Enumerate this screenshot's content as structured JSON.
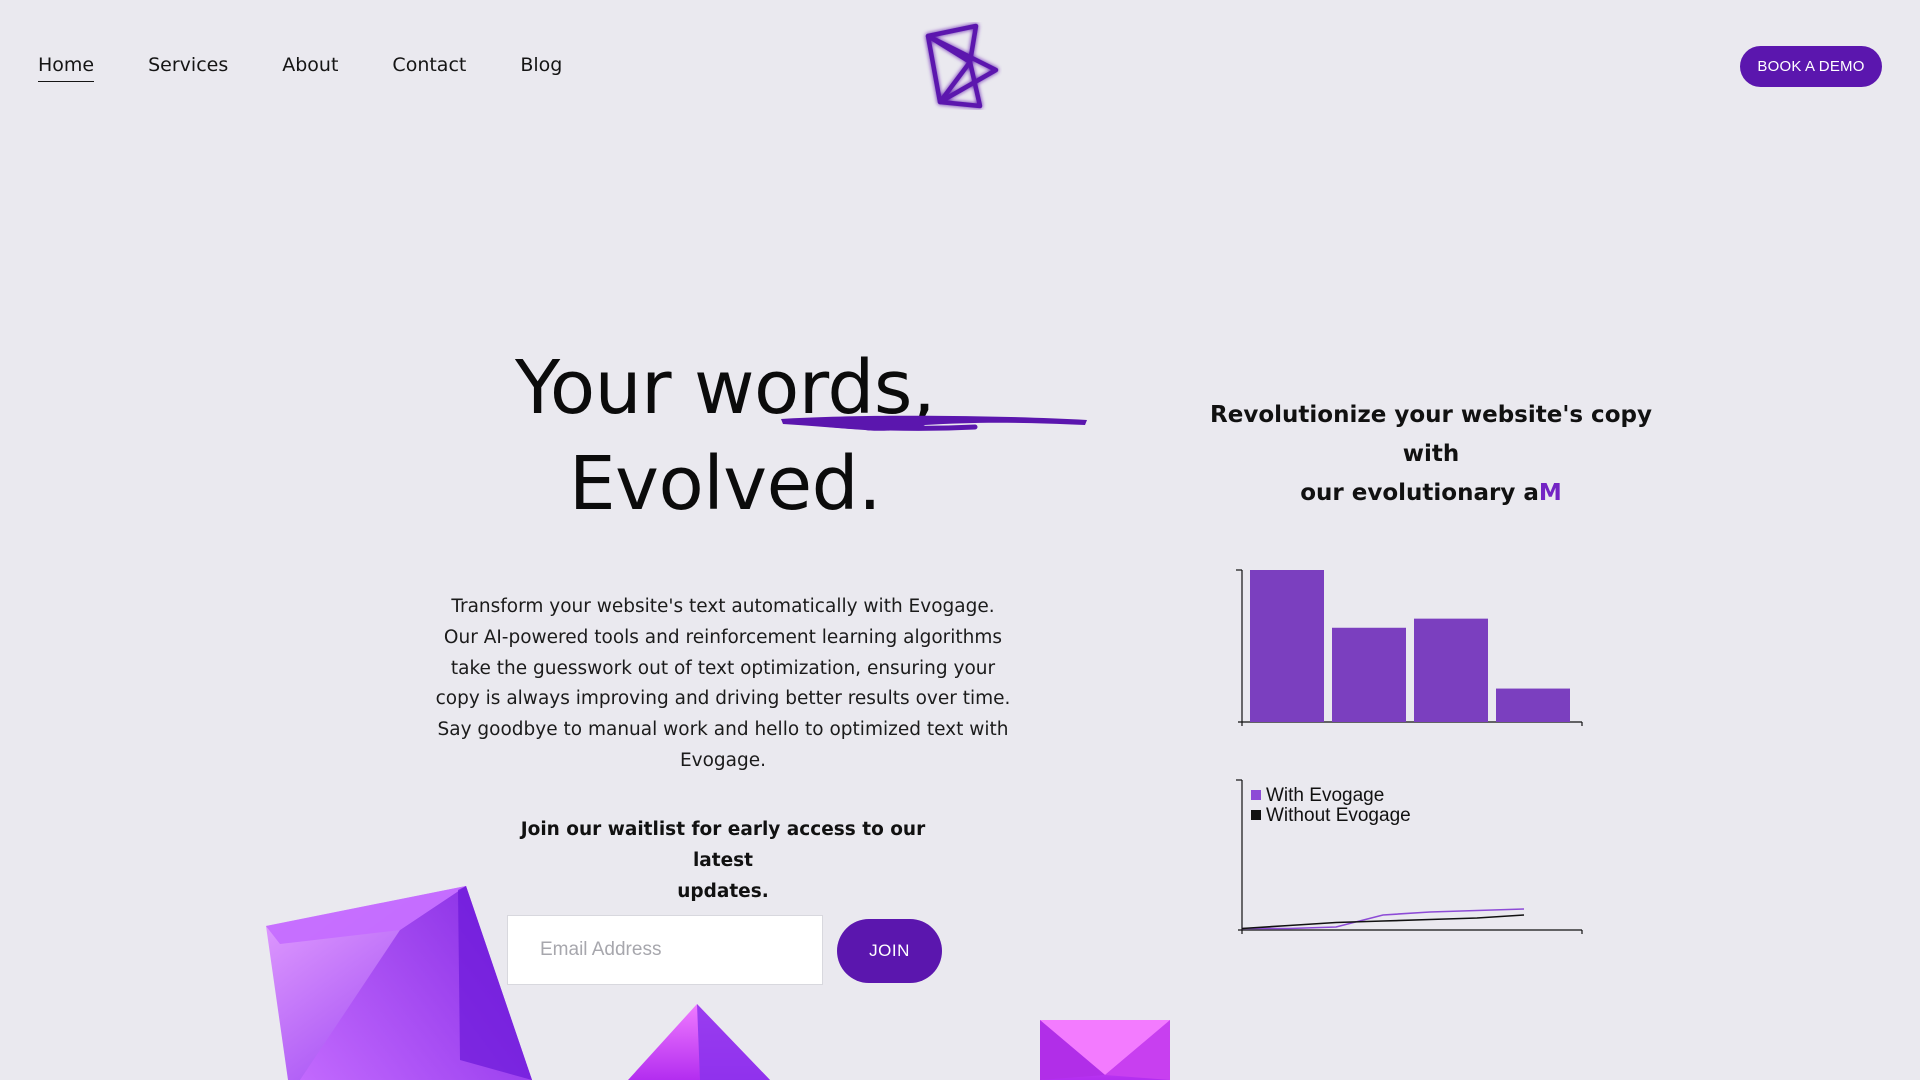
{
  "nav": {
    "items": [
      {
        "label": "Home",
        "active": true
      },
      {
        "label": "Services",
        "active": false
      },
      {
        "label": "About",
        "active": false
      },
      {
        "label": "Contact",
        "active": false
      },
      {
        "label": "Blog",
        "active": false
      }
    ],
    "cta_label": "BOOK A DEMO"
  },
  "hero": {
    "title_lead": "Your words, ",
    "title_accent": "Evolved."
  },
  "tagline": {
    "line1": "Revolutionize your website's copy with",
    "line2_lead": "our evolutionary a",
    "line2_accent": "M"
  },
  "body": {
    "lines": [
      "Transform your website's text automatically with Evogage.",
      "Our AI-powered tools and reinforcement learning algorithms",
      "take the guesswork out of text optimization, ensuring your",
      "copy is always improving and driving better results over time.",
      "Say goodbye to manual work and hello to optimized text with",
      "Evogage."
    ]
  },
  "waitlist": {
    "line1": "Join our waitlist for early access to our latest",
    "line2": "updates."
  },
  "form": {
    "email_placeholder": "Email Address",
    "email_value": "",
    "join_label": "JOIN"
  },
  "colors": {
    "accent": "#5b16ae",
    "bar": "#7b3fbf",
    "with_line": "#8d4bd6",
    "without_line": "#111111",
    "background": "#eae9ef"
  },
  "chart_data": [
    {
      "type": "bar",
      "categories": [
        "",
        "",
        "",
        ""
      ],
      "values": [
        100,
        62,
        68,
        22
      ],
      "ylim": [
        0,
        100
      ],
      "grid": false
    },
    {
      "type": "line",
      "x": [
        0,
        1,
        2,
        3,
        4,
        5,
        6
      ],
      "ylim": [
        0,
        100
      ],
      "legend": "top-left",
      "grid": false,
      "series": [
        {
          "name": "With Evogage",
          "values": [
            1,
            1,
            2,
            10,
            12,
            13,
            14
          ]
        },
        {
          "name": "Without Evogage",
          "values": [
            1,
            3,
            5,
            6,
            7,
            8,
            10
          ]
        }
      ]
    }
  ]
}
